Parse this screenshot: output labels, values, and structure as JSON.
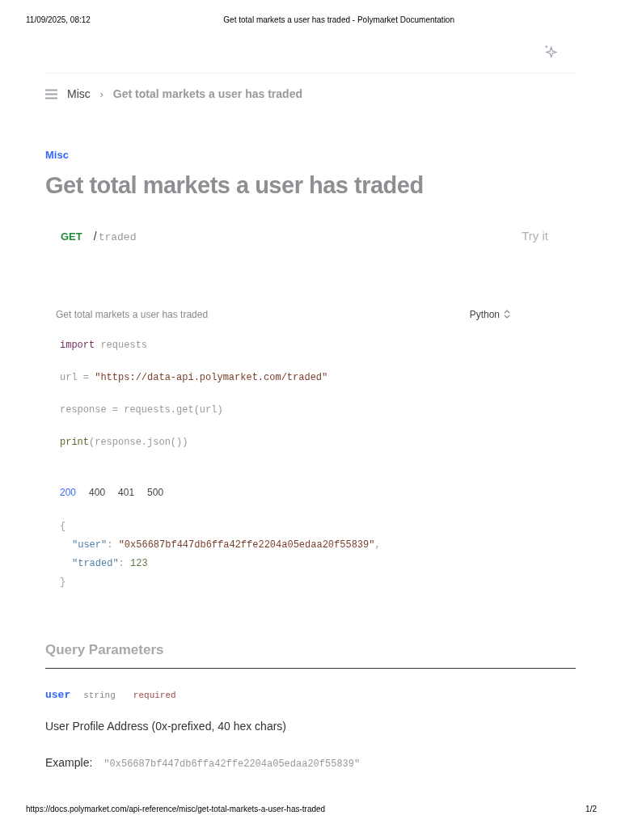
{
  "print_header": {
    "date": "11/09/2025, 08:12",
    "title": "Get total markets a user has traded - Polymarket Documentation"
  },
  "breadcrumb": {
    "section": "Misc",
    "separator": "›",
    "current": "Get total markets a user has traded"
  },
  "eyebrow": "Misc",
  "title": "Get total markets a user has traded",
  "endpoint": {
    "method": "GET",
    "slash": "/",
    "path": "traded",
    "try_it": "Try it"
  },
  "code_sample": {
    "title": "Get total markets a user has traded",
    "language": "Python",
    "lines": [
      [
        {
          "kind": "keyword",
          "text": "import"
        },
        {
          "kind": "plain",
          "text": " requests"
        }
      ],
      [
        {
          "kind": "plain",
          "text": "url = "
        },
        {
          "kind": "string",
          "text": "\"https://data-api.polymarket.com/traded\""
        }
      ],
      [
        {
          "kind": "plain",
          "text": "response = requests.get(url)"
        }
      ],
      [
        {
          "kind": "function",
          "text": "print"
        },
        {
          "kind": "plain",
          "text": "(response.json())"
        }
      ]
    ]
  },
  "response": {
    "tabs": [
      {
        "label": "200",
        "selected": true
      },
      {
        "label": "400",
        "selected": false
      },
      {
        "label": "401",
        "selected": false
      },
      {
        "label": "500",
        "selected": false
      }
    ],
    "lines": [
      [
        {
          "kind": "punct",
          "text": "{"
        }
      ],
      [
        {
          "kind": "key",
          "text": "\"user\""
        },
        {
          "kind": "punct",
          "text": ": "
        },
        {
          "kind": "string",
          "text": "\"0x56687bf447db6ffa42ffe2204a05edaa20f55839\""
        },
        {
          "kind": "punct",
          "text": ","
        }
      ],
      [
        {
          "kind": "key",
          "text": "\"traded\""
        },
        {
          "kind": "punct",
          "text": ": "
        },
        {
          "kind": "number",
          "text": "123"
        }
      ],
      [
        {
          "kind": "punct",
          "text": "}"
        }
      ]
    ]
  },
  "query_parameters": {
    "heading": "Query Parameters",
    "params": [
      {
        "name": "user",
        "type": "string",
        "required": "required",
        "description": "User Profile Address (0x-prefixed, 40 hex chars)",
        "example_label": "Example:",
        "example": "\"0x56687bf447db6ffa42ffe2204a05edaa20f55839\""
      }
    ]
  },
  "print_footer": {
    "url": "https://docs.polymarket.com/api-reference/misc/get-total-markets-a-user-has-traded",
    "page": "1/2"
  }
}
